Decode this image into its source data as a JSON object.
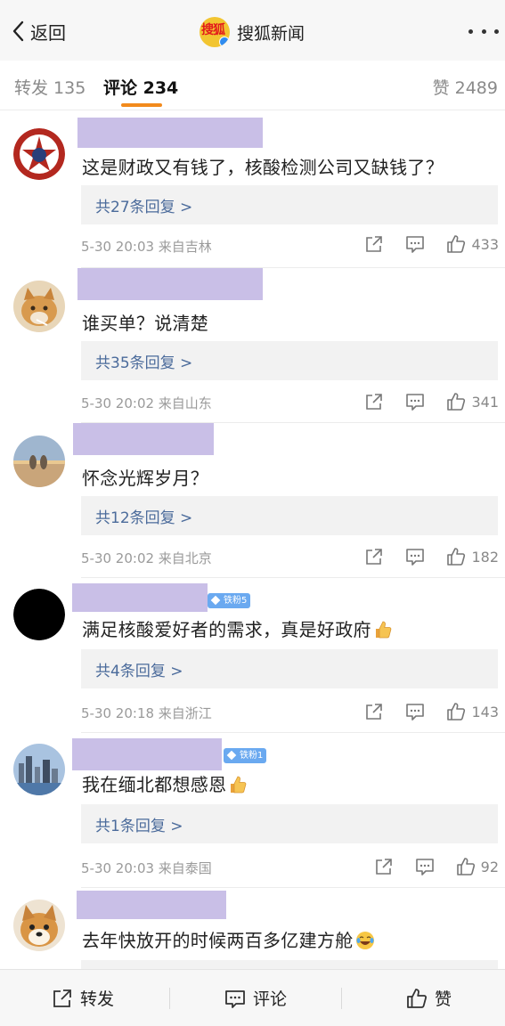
{
  "navbar": {
    "back_label": "返回",
    "account_name": "搜狐新闻",
    "logo_text": "搜狐",
    "more_icon": "more-dots-icon"
  },
  "tabs": {
    "repost": "转发 135",
    "comment": "评论 234",
    "like": "赞 2489"
  },
  "colors": {
    "accent": "#f28a1c",
    "link": "#4b6b9b",
    "name_placeholder": "#c9bfe7",
    "fan_badge": "#6aa9f0"
  },
  "comments": [
    {
      "text": "这是财政又有钱了，核酸检测公司又缺钱了？",
      "reply_label": "共27条回复 >",
      "meta": "5-30 20:03  来自吉林",
      "likes": "433",
      "emoji": ""
    },
    {
      "text": "谁买单？说清楚",
      "reply_label": "共35条回复 >",
      "meta": "5-30 20:02  来自山东",
      "likes": "341",
      "emoji": ""
    },
    {
      "text": "怀念光辉岁月？",
      "reply_label": "共12条回复 >",
      "meta": "5-30 20:02  来自北京",
      "likes": "182",
      "emoji": ""
    },
    {
      "text": "满足核酸爱好者的需求，真是好政府",
      "reply_label": "共4条回复 >",
      "meta": "5-30 20:18  来自浙江",
      "likes": "143",
      "badge": "铁粉5",
      "emoji": "thumbs-up-emoji"
    },
    {
      "text": "我在缅北都想感恩",
      "reply_label": "共1条回复 >",
      "meta": "5-30 20:03  来自泰国",
      "likes": "92",
      "badge": "铁粉1",
      "emoji": "thumbs-up-emoji"
    },
    {
      "text": "去年快放开的时候两百多亿建方舱",
      "emoji": "laugh-cry-emoji"
    }
  ],
  "bottombar": {
    "repost": "转发",
    "comment": "评论",
    "like": "赞"
  }
}
